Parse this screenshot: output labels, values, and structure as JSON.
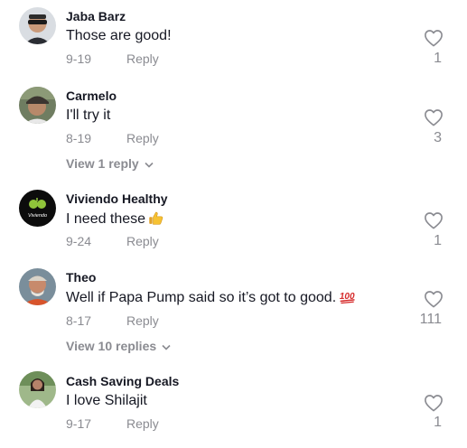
{
  "comments": [
    {
      "username": "Jaba Barz",
      "text": "Those are good!",
      "date": "9-19",
      "reply_label": "Reply",
      "likes": "1",
      "avatar": "man-with-sunglasses"
    },
    {
      "username": "Carmelo",
      "text": "I'll try it",
      "date": "8-19",
      "reply_label": "Reply",
      "likes": "3",
      "view_replies": "View 1 reply",
      "avatar": "man-with-cap"
    },
    {
      "username": "Viviendo Healthy",
      "text": "I need these",
      "emoji": "thumbs-up",
      "date": "9-24",
      "reply_label": "Reply",
      "likes": "1",
      "avatar": "viviendo-logo",
      "avatar_text": "Viviendo"
    },
    {
      "username": "Theo",
      "text": "Well if Papa Pump said so it’s got to good.",
      "emoji": "hundred-points",
      "date": "8-17",
      "reply_label": "Reply",
      "likes": "111",
      "view_replies": "View 10 replies",
      "avatar": "older-man"
    },
    {
      "username": "Cash Saving Deals",
      "text": "I love Shilajit",
      "date": "9-17",
      "reply_label": "Reply",
      "likes": "1",
      "avatar": "woman-outdoors"
    }
  ],
  "colors": {
    "primary_text": "#161823",
    "secondary_text": "#8a8b91",
    "background": "#ffffff"
  }
}
